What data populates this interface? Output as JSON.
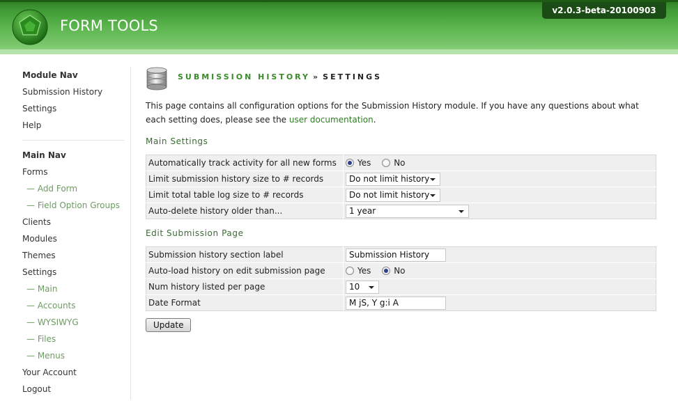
{
  "header": {
    "brand": "FORM TOOLS",
    "version": "v2.0.3-beta-20100903"
  },
  "sidebar": {
    "module_nav": {
      "heading": "Module Nav",
      "items": [
        "Submission History",
        "Settings",
        "Help"
      ]
    },
    "main_nav": {
      "heading": "Main Nav",
      "forms": "Forms",
      "add_form": "— Add Form",
      "field_option_groups": "— Field Option Groups",
      "clients": "Clients",
      "modules": "Modules",
      "themes": "Themes",
      "settings": "Settings",
      "settings_main": "— Main",
      "settings_accounts": "— Accounts",
      "settings_wysiwyg": "— WYSIWYG",
      "settings_files": "— Files",
      "settings_menus": "— Menus",
      "your_account": "Your Account",
      "logout": "Logout"
    }
  },
  "main": {
    "title_part1": "SUBMISSION HISTORY",
    "title_sep": "»",
    "title_part2": "SETTINGS",
    "intro_text": "This page contains all configuration options for the Submission History module. If you have any questions about what each setting does, please see the ",
    "intro_link": "user documentation",
    "intro_end": ".",
    "main_settings": {
      "title": "Main Settings",
      "track_label": "Automatically track activity for all new forms",
      "track_yes": "Yes",
      "track_no": "No",
      "track_value": "Yes",
      "limit_sub_label": "Limit submission history size to # records",
      "limit_sub_value": "Do not limit history",
      "limit_total_label": "Limit total table log size to # records",
      "limit_total_value": "Do not limit history",
      "auto_delete_label": "Auto-delete history older than...",
      "auto_delete_value": "1 year"
    },
    "edit_page": {
      "title": "Edit Submission Page",
      "section_label_label": "Submission history section label",
      "section_label_value": "Submission History",
      "autoload_label": "Auto-load history on edit submission page",
      "autoload_yes": "Yes",
      "autoload_no": "No",
      "autoload_value": "No",
      "num_history_label": "Num history listed per page",
      "num_history_value": "10",
      "date_format_label": "Date Format",
      "date_format_value": "M jS, Y g:i A"
    },
    "update_button": "Update"
  },
  "colors": {
    "brand_green": "#3f9a34",
    "dark_green": "#1c4c15",
    "link_green": "#2f7d24",
    "sub_nav_green": "#6e9a63"
  }
}
